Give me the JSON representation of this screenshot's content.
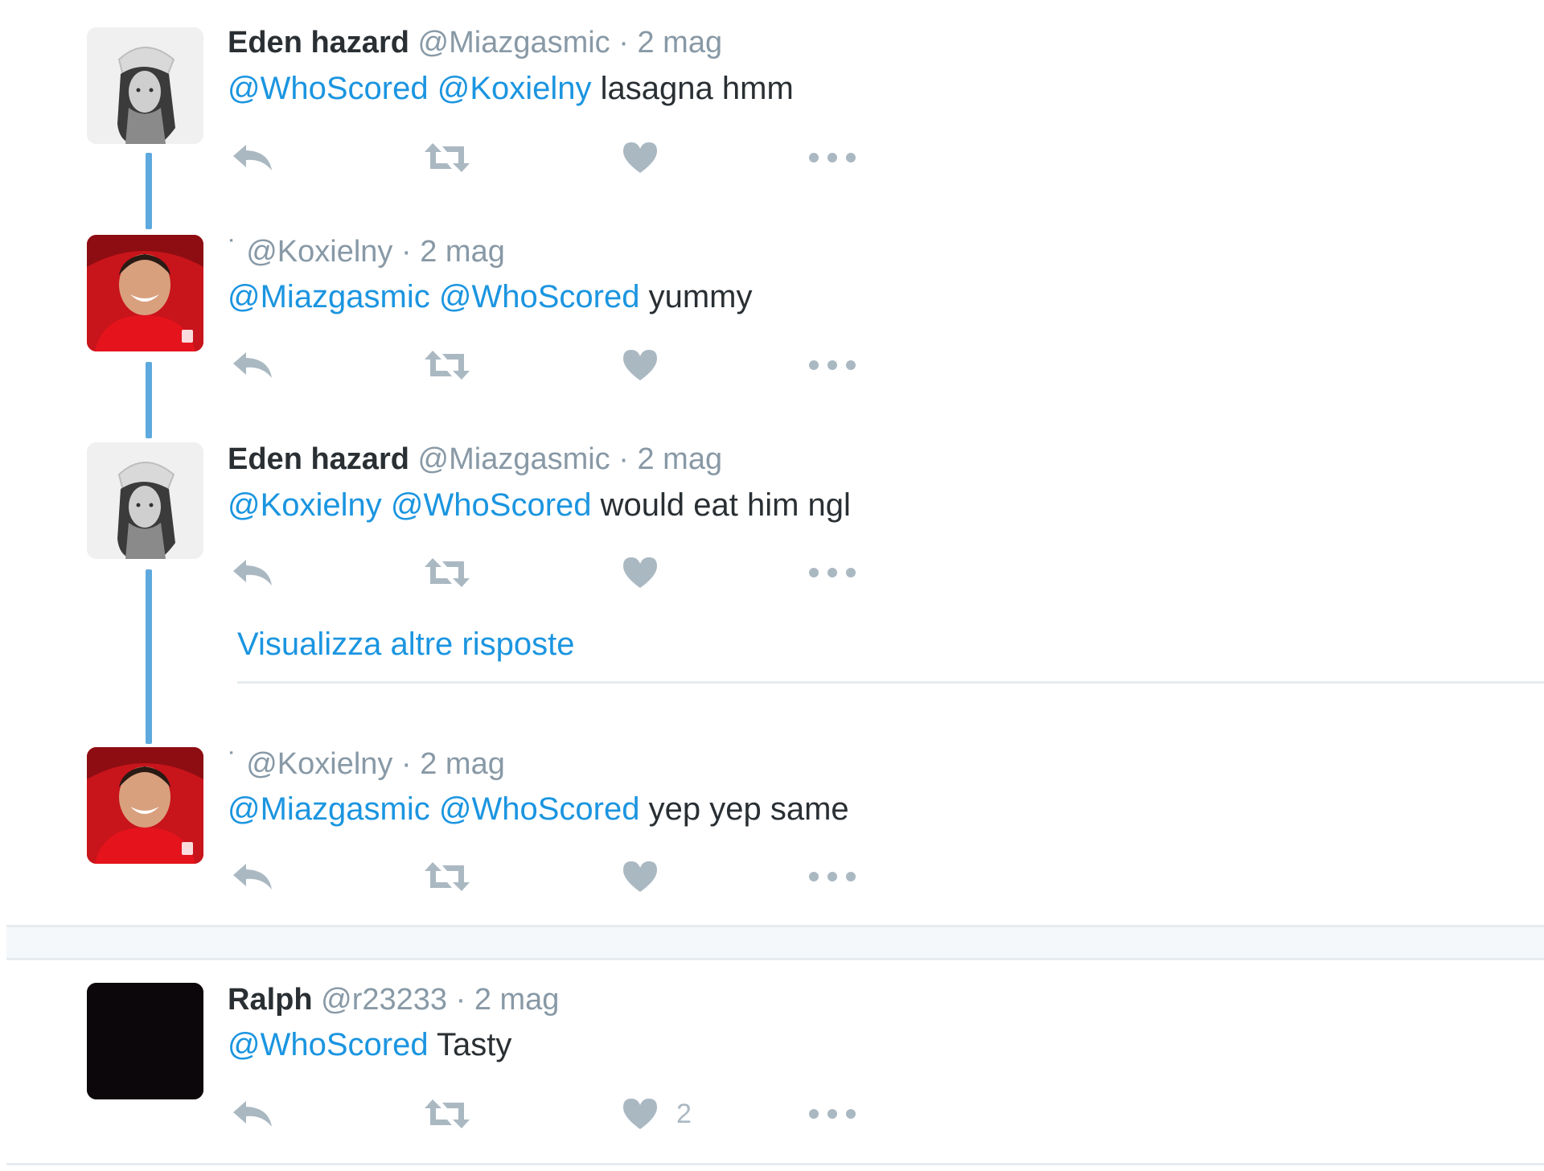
{
  "tweets": [
    {
      "display_name": "Eden hazard",
      "handle": "@Miazgasmic",
      "separator": "·",
      "timestamp": "2 mag",
      "mentions": [
        "@WhoScored",
        "@Koxielny"
      ],
      "text": "lasagna hmm",
      "avatar": "avatar-grayscale-woman-photo"
    },
    {
      "display_name": "",
      "name_mark": "˙",
      "handle": "@Koxielny",
      "separator": "·",
      "timestamp": "2 mag",
      "mentions": [
        "@Miazgasmic",
        "@WhoScored"
      ],
      "text": "yummy",
      "avatar": "avatar-red-shirt-man-photo"
    },
    {
      "display_name": "Eden hazard",
      "handle": "@Miazgasmic",
      "separator": "·",
      "timestamp": "2 mag",
      "mentions": [
        "@Koxielny",
        "@WhoScored"
      ],
      "text": "would eat him ngl",
      "avatar": "avatar-grayscale-woman-photo"
    },
    {
      "display_name": "",
      "name_mark": "˙",
      "handle": "@Koxielny",
      "separator": "·",
      "timestamp": "2 mag",
      "mentions": [
        "@Miazgasmic",
        "@WhoScored"
      ],
      "text": "yep yep same",
      "avatar": "avatar-red-shirt-man-photo"
    },
    {
      "display_name": "Ralph",
      "handle": "@r23233",
      "separator": "·",
      "timestamp": "2 mag",
      "mentions": [
        "@WhoScored"
      ],
      "text": "Tasty",
      "avatar": "avatar-black-square",
      "like_count": "2"
    }
  ],
  "thread": {
    "show_more_label": "Visualizza altre risposte"
  },
  "icons": {
    "reply": "reply-icon",
    "retweet": "retweet-icon",
    "like": "heart-icon",
    "more": "more-dots-icon"
  },
  "colors": {
    "mention": "#1b95e0",
    "thread_line": "#5ea9dd",
    "meta_gray": "#8899a6",
    "icon_gray": "#aab8c2",
    "text": "#292f33"
  }
}
